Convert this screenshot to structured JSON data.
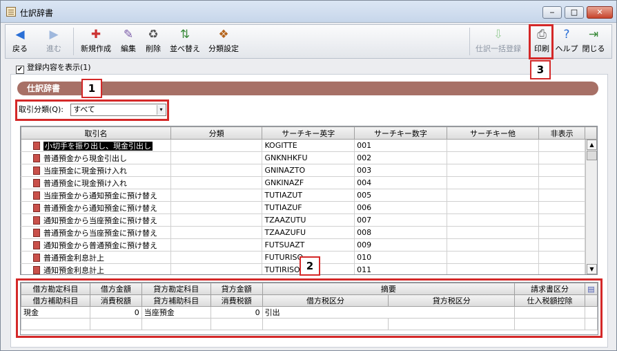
{
  "window": {
    "title": "仕訳辞書"
  },
  "toolbar": {
    "back": "戻る",
    "forward": "進む",
    "new": "新規作成",
    "edit": "編集",
    "delete": "削除",
    "sort": "並べ替え",
    "category": "分類設定",
    "bulk": "仕訳一括登録",
    "print": "印刷",
    "help": "ヘルプ",
    "close": "閉じる"
  },
  "show_registration": {
    "label": "登録内容を表示(1)",
    "checked": true
  },
  "section": {
    "title": "仕訳辞書"
  },
  "filter": {
    "label": "取引分類(Q):",
    "value": "すべて"
  },
  "grid": {
    "columns": [
      "取引名",
      "分類",
      "サーチキー英字",
      "サーチキー数字",
      "サーチキー他",
      "非表示"
    ],
    "rows": [
      {
        "name": "小切手を振り出し、現金引出し",
        "alpha": "KOGITTE",
        "num": "001"
      },
      {
        "name": "普通預金から現金引出し",
        "alpha": "GNKNHKFU",
        "num": "002"
      },
      {
        "name": "当座預金に現金預け入れ",
        "alpha": "GNINAZTO",
        "num": "003"
      },
      {
        "name": "普通預金に現金預け入れ",
        "alpha": "GNKINAZF",
        "num": "004"
      },
      {
        "name": "当座預金から通知預金に預け替え",
        "alpha": "TUTIAZUT",
        "num": "005"
      },
      {
        "name": "普通預金から通知預金に預け替え",
        "alpha": "TUTIAZUF",
        "num": "006"
      },
      {
        "name": "通知預金から当座預金に預け替え",
        "alpha": "TZAAZUTU",
        "num": "007"
      },
      {
        "name": "普通預金から当座預金に預け替え",
        "alpha": "TZAAZUFU",
        "num": "008"
      },
      {
        "name": "通知預金から普通預金に預け替え",
        "alpha": "FUTSUAZT",
        "num": "009"
      },
      {
        "name": "普通預金利息計上",
        "alpha": "FUTURISO",
        "num": "010"
      },
      {
        "name": "通知預金利息計上",
        "alpha": "TUTIRISO",
        "num": "011"
      }
    ]
  },
  "detail": {
    "h1": [
      "借方勘定科目",
      "借方金額",
      "貸方勘定科目",
      "貸方金額",
      "摘要",
      "請求書区分"
    ],
    "h2": [
      "借方補助科目",
      "消費税額",
      "貸方補助科目",
      "消費税額",
      "借方税区分",
      "貸方税区分",
      "仕入税額控除"
    ],
    "row": {
      "debit_account": "現金",
      "debit_amount": "0",
      "credit_account": "当座預金",
      "credit_amount": "0",
      "summary": "引出"
    }
  },
  "callouts": [
    "1",
    "2",
    "3"
  ]
}
